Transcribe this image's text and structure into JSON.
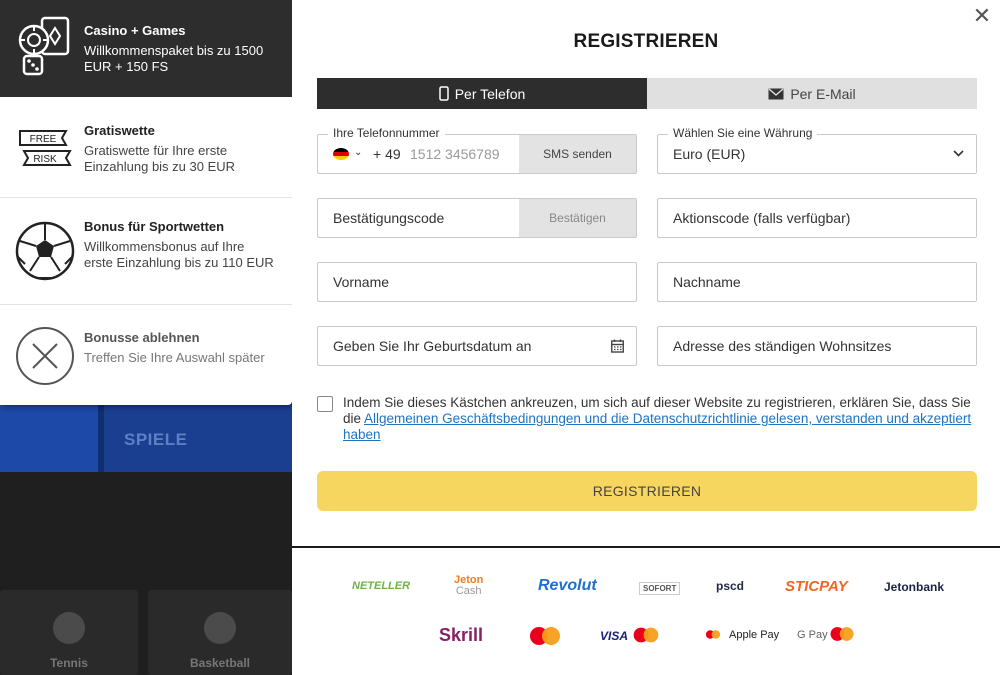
{
  "background": {
    "spiele_label": "SPIELE",
    "tiles": [
      {
        "label": "Tennis"
      },
      {
        "label": "Basketball"
      }
    ]
  },
  "bonuses": [
    {
      "title": "Casino + Games",
      "desc": "Willkommenspaket bis zu 1500 EUR + 150 FS",
      "icon": "casino-chips-icon",
      "selected": true
    },
    {
      "title": "Gratiswette",
      "desc": "Gratiswette für Ihre erste Einzahlung bis zu 30 EUR",
      "icon": "free-risk-icon",
      "icon_text": [
        "FREE",
        "RISK"
      ]
    },
    {
      "title": "Bonus für Sportwetten",
      "desc": "Willkommensbonus auf Ihre erste Einzahlung bis zu 110 EUR",
      "icon": "soccer-ball-icon"
    },
    {
      "title": "Bonusse ablehnen",
      "desc": "Treffen Sie Ihre Auswahl später",
      "icon": "decline-x-icon"
    }
  ],
  "modal": {
    "title": "REGISTRIEREN",
    "close_icon": "close-icon",
    "tabs": [
      {
        "label": "Per Telefon",
        "icon": "phone-icon",
        "active": true
      },
      {
        "label": "Per E-Mail",
        "icon": "envelope-icon",
        "active": false
      }
    ],
    "phone": {
      "label": "Ihre Telefonnummer",
      "prefix": "+ 49",
      "placeholder": "1512 3456789",
      "sms_button": "SMS senden",
      "flag_colors": [
        "#000000",
        "#dd0000",
        "#ffce00"
      ]
    },
    "currency": {
      "label": "Wählen Sie eine Währung",
      "value": "Euro (EUR)"
    },
    "confirm_code": {
      "placeholder": "Bestätigungscode",
      "button": "Bestätigen"
    },
    "promo_code": {
      "placeholder": "Aktionscode (falls verfügbar)"
    },
    "first_name": {
      "placeholder": "Vorname"
    },
    "last_name": {
      "placeholder": "Nachname"
    },
    "birthdate": {
      "placeholder": "Geben Sie Ihr Geburtsdatum an",
      "icon": "calendar-icon"
    },
    "address": {
      "placeholder": "Adresse des ständigen Wohnsitzes"
    },
    "consent": {
      "text_before": "Indem Sie dieses Kästchen ankreuzen, um sich auf dieser Website zu registrieren, erklären Sie, dass Sie die ",
      "link_text": "Allgemeinen Geschäftsbedingungen und die Datenschutzrichtlinie gelesen, verstanden und akzeptiert haben"
    },
    "submit_label": "REGISTRIEREN",
    "submit_color": "#f7d660"
  },
  "payments": {
    "row1": [
      {
        "name": "NETELLER",
        "color": "#6fb43f"
      },
      {
        "name": "Jeton",
        "sub": "Cash",
        "color": "#f07c1f"
      },
      {
        "name": "Revolut",
        "color": "#1f6fd1"
      },
      {
        "name": "SOFORT",
        "color": "#555555"
      },
      {
        "name": "pscd",
        "color": "#1f2a44"
      },
      {
        "name": "STICPAY",
        "color": "#f26522"
      },
      {
        "name": "Jetonbank",
        "color": "#1b2340"
      }
    ],
    "row2": [
      {
        "name": "Skrill",
        "color": "#862165"
      },
      {
        "name": "mastercard",
        "color": "#eb001b"
      },
      {
        "name": "VISA",
        "color": "#1a1f71"
      },
      {
        "name": "Apple Pay",
        "color": "#222222"
      },
      {
        "name": "G Pay",
        "color": "#5f6368"
      }
    ]
  }
}
